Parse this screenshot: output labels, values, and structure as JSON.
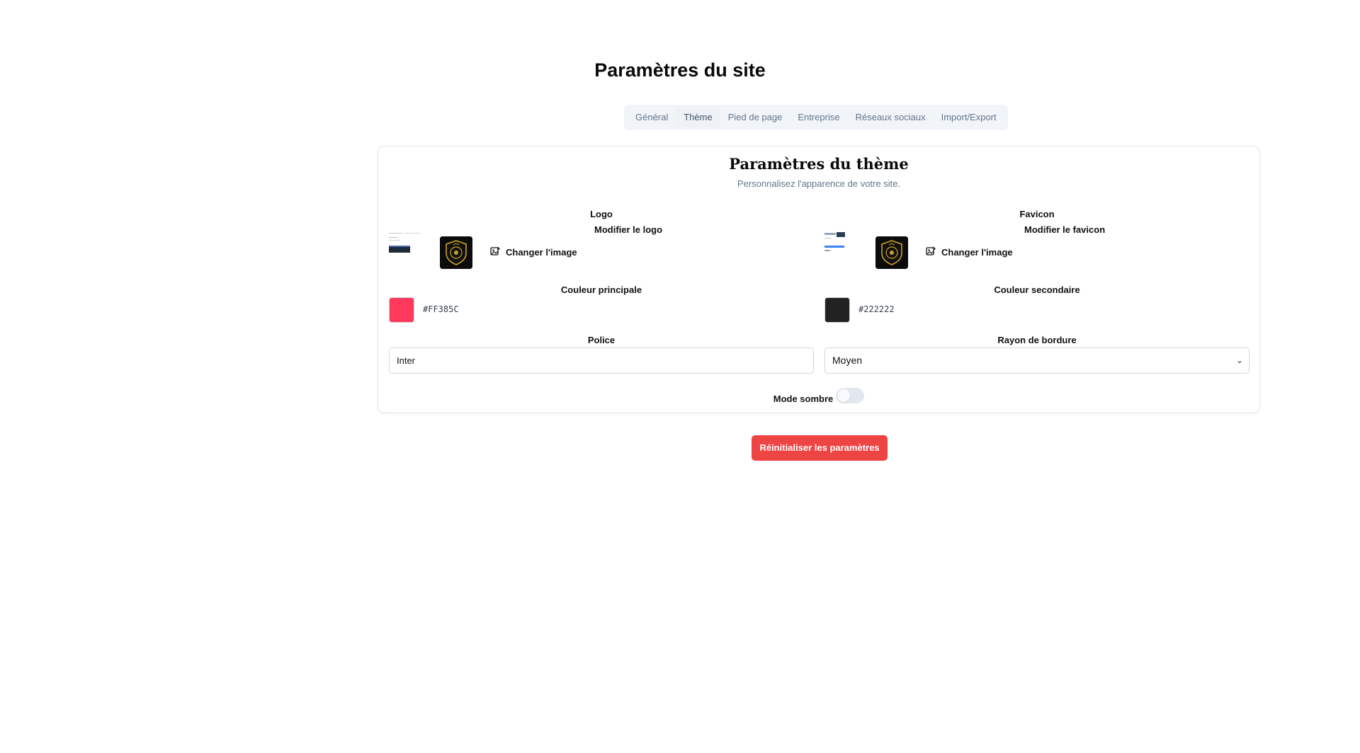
{
  "page": {
    "title": "Paramètres du site"
  },
  "tabs": [
    {
      "label": "Général"
    },
    {
      "label": "Thème",
      "active": true
    },
    {
      "label": "Pied de page"
    },
    {
      "label": "Entreprise"
    },
    {
      "label": "Réseaux sociaux"
    },
    {
      "label": "Import/Export"
    }
  ],
  "theme": {
    "title": "Paramètres du thème",
    "subtitle": "Personnalisez l'apparence de votre site.",
    "logo": {
      "label": "Logo",
      "edit_label": "Modifier le logo",
      "change_button": "Changer l'image",
      "icon": "image-edit-icon"
    },
    "favicon": {
      "label": "Favicon",
      "edit_label": "Modifier le favicon",
      "change_button": "Changer l'image",
      "icon": "image-edit-icon"
    },
    "primary_color": {
      "label": "Couleur principale",
      "value": "#FF385C"
    },
    "secondary_color": {
      "label": "Couleur secondaire",
      "value": "#222222"
    },
    "font": {
      "label": "Police",
      "value": "Inter"
    },
    "border_radius": {
      "label": "Rayon de bordure",
      "value": "Moyen"
    },
    "dark_mode": {
      "label": "Mode sombre",
      "enabled": false
    }
  },
  "actions": {
    "reset_label": "Réinitialiser les paramètres"
  },
  "colors": {
    "accent_red": "#ef4444",
    "tab_bg": "#f1f5f9",
    "muted_text": "#64748b"
  }
}
